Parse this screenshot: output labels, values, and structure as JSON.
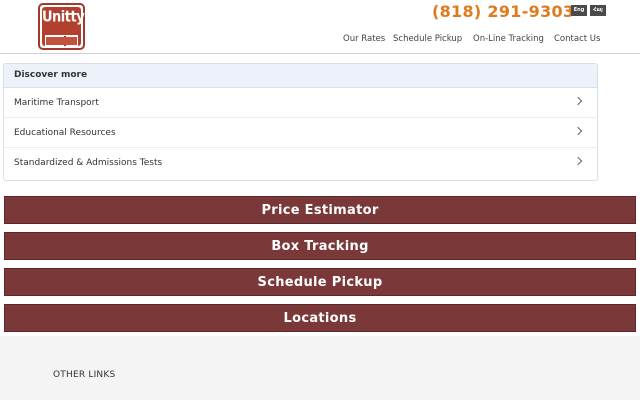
{
  "header": {
    "logo_text": "Unitty",
    "logo_tagline": "SHIPPING GROUP",
    "phone": "(818) 291-9303",
    "languages": [
      "Eng",
      "Հայ"
    ],
    "nav": [
      "Our Rates",
      "Schedule Pickup",
      "On-Line Tracking",
      "Contact Us"
    ]
  },
  "discover": {
    "title": "Discover more",
    "items": [
      {
        "label": "Maritime Transport"
      },
      {
        "label": "Educational Resources"
      },
      {
        "label": "Standardized & Admissions Tests"
      }
    ]
  },
  "actions": {
    "price_estimator": "Price Estimator",
    "box_tracking": "Box Tracking",
    "schedule_pickup": "Schedule Pickup",
    "locations": "Locations"
  },
  "footer": {
    "links_heading": "OTHER LINKS"
  },
  "colors": {
    "accent_orange": "#e07a1f",
    "button_maroon": "#7a3838",
    "logo_red": "#b3402f"
  }
}
